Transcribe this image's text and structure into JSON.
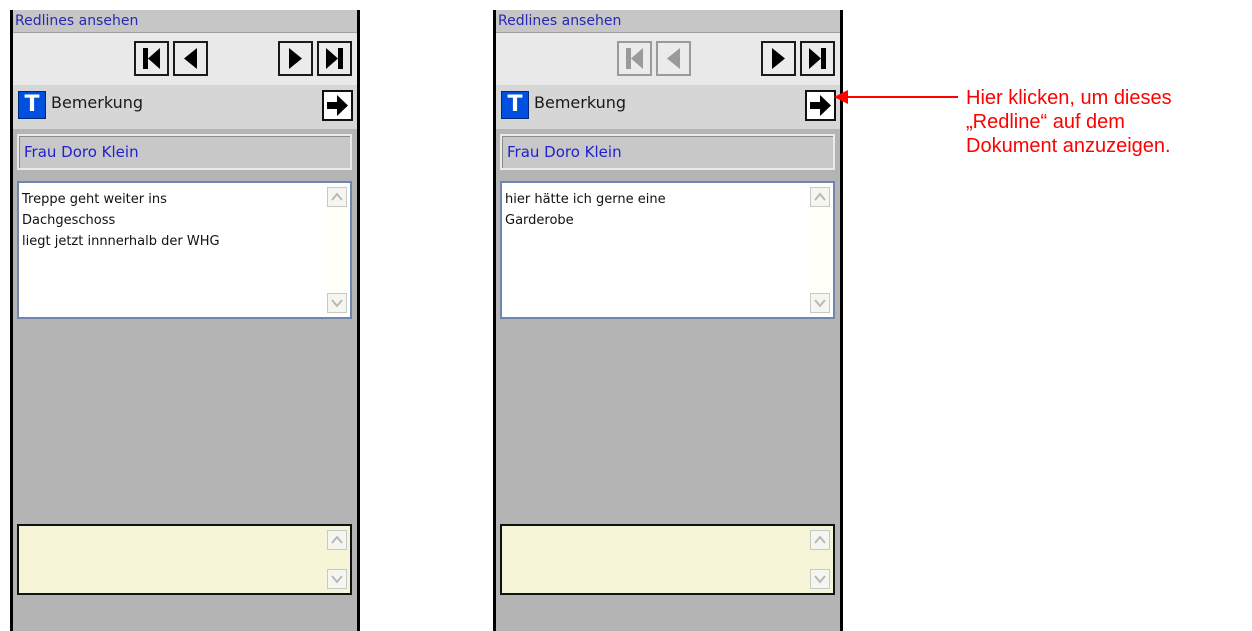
{
  "panels": [
    {
      "title": "Redlines ansehen",
      "first_prev_disabled": false,
      "type_icon": "T",
      "type_label": "Bemerkung",
      "author": "Frau Doro Klein",
      "comment": "Treppe geht weiter ins\nDachgeschoss\nliegt jetzt innnerhalb der WHG",
      "reply": ""
    },
    {
      "title": "Redlines ansehen",
      "first_prev_disabled": true,
      "type_icon": "T",
      "type_label": "Bemerkung",
      "author": "Frau Doro Klein",
      "comment": "hier hätte ich gerne eine\nGarderobe",
      "reply": ""
    }
  ],
  "annotation": {
    "line1": "Hier klicken, um dieses",
    "line2": "„Redline“ auf dem",
    "line3": "Dokument anzuzeigen.",
    "color": "#ff0000"
  },
  "icons": {
    "nav_first": "first-record-icon",
    "nav_prev": "previous-record-icon",
    "nav_next": "next-record-icon",
    "nav_last": "last-record-icon",
    "show_on_document": "arrow-right-icon",
    "type": "text-type-icon"
  }
}
